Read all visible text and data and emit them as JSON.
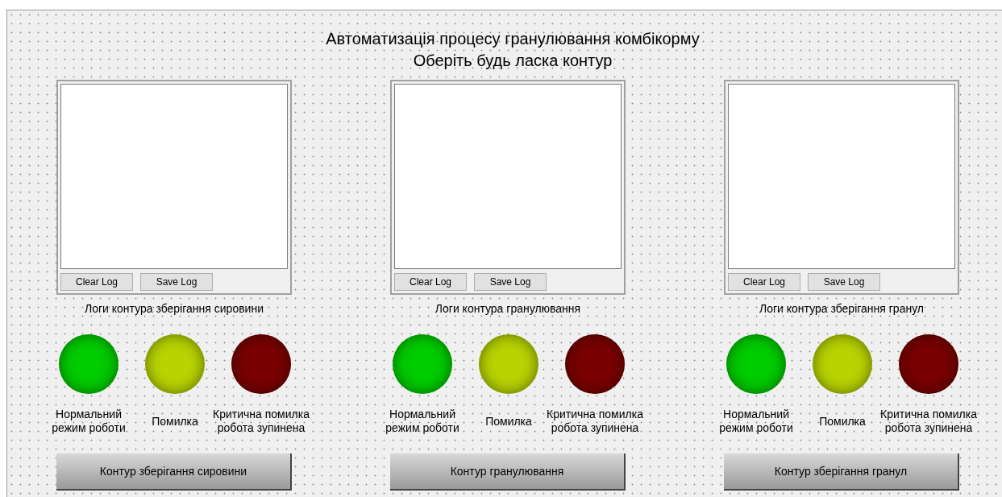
{
  "form": {
    "title_lines": [
      "Автоматизація процесу гранулювання комбікорму",
      "Оберіть будь ласка контур"
    ]
  },
  "circuits": [
    {
      "log_buttons": [
        "Clear Log",
        "Save Log"
      ],
      "log_caption": "Логи контура зберігання сировини",
      "lights": [
        {
          "color": "#00cc00",
          "label": "Нормальний режим роботи"
        },
        {
          "color": "#b8d400",
          "label": "Помилка"
        },
        {
          "color": "#7a0000",
          "label": "Критична помилка робота зупинена"
        }
      ],
      "button": "Контур зберігання сировини"
    },
    {
      "log_buttons": [
        "Clear Log",
        "Save Log"
      ],
      "log_caption": "Логи контура гранулювання",
      "lights": [
        {
          "color": "#00cc00",
          "label": "Нормальний режим роботи"
        },
        {
          "color": "#b8d400",
          "label": "Помилка"
        },
        {
          "color": "#7a0000",
          "label": "Критична помилка робота зупинена"
        }
      ],
      "button": "Контур гранулювання"
    },
    {
      "log_buttons": [
        "Clear Log",
        "Save Log"
      ],
      "log_caption": "Логи контура зберігання гранул",
      "lights": [
        {
          "color": "#00cc00",
          "label": "Нормальний режим роботи"
        },
        {
          "color": "#b8d400",
          "label": "Помилка"
        },
        {
          "color": "#7a0000",
          "label": "Критична помилка робота зупинена"
        }
      ],
      "button": "Контур зберігання гранул"
    }
  ]
}
